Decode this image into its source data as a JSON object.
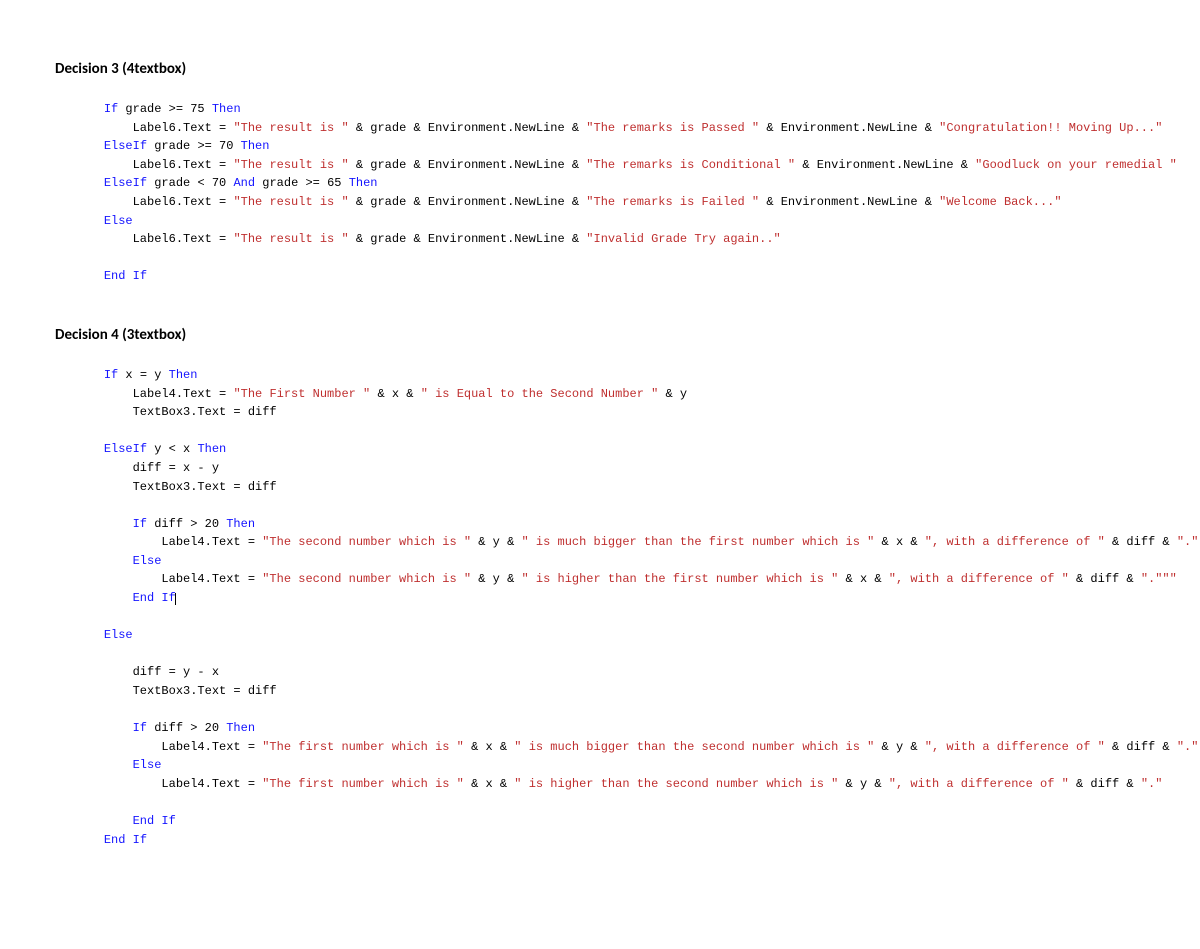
{
  "headings": {
    "h1": "Decision 3 (4textbox)",
    "h2": "Decision 4 (3textbox)"
  },
  "code3": {
    "if1": "If",
    "cond1": " grade >= 75 ",
    "then": "Then",
    "l1a": "        Label6.Text = ",
    "s1a": "\"The result is \"",
    "mid1": " & grade & Environment.NewLine & ",
    "s1b": "\"The remarks is Passed \"",
    "mid1b": " & Environment.NewLine & ",
    "s1c": "\"Congratulation!! Moving Up...\"",
    "elif1": "ElseIf",
    "cond2": " grade >= 70 ",
    "l2a": "        Label6.Text = ",
    "s2a": "\"The result is \"",
    "mid2": " & grade & Environment.NewLine & ",
    "s2b": "\"The remarks is Conditional \"",
    "mid2b": " & Environment.NewLine & ",
    "s2c": "\"Goodluck on your remedial \"",
    "elif2": "ElseIf",
    "cond3a": " grade < 70 ",
    "and": "And",
    "cond3b": " grade >= 65 ",
    "l3a": "        Label6.Text = ",
    "s3a": "\"The result is \"",
    "mid3": " & grade & Environment.NewLine & ",
    "s3b": "\"The remarks is Failed \"",
    "mid3b": " & Environment.NewLine & ",
    "s3c": "\"Welcome Back...\"",
    "else": "Else",
    "l4a": "        Label6.Text = ",
    "s4a": "\"The result is \"",
    "mid4": " & grade & Environment.NewLine & ",
    "s4b": "\"Invalid Grade Try again..\"",
    "endif": "End If"
  },
  "code4": {
    "if1": "If",
    "cond1": " x = y ",
    "then": "Then",
    "l1": "        Label4.Text = ",
    "s1a": "\"The First Number \"",
    "m1a": " & x & ",
    "s1b": "\" is Equal to the Second Number \"",
    "m1b": " & y",
    "l2": "        TextBox3.Text = diff",
    "elif": "ElseIf",
    "cond2": " y < x ",
    "l3": "        diff = x - y",
    "l4": "        TextBox3.Text = diff",
    "if2": "If",
    "cond3": " diff > 20 ",
    "l5": "            Label4.Text = ",
    "s5a": "\"The second number which is \"",
    "m5a": " & y & ",
    "s5b": "\" is much bigger than the first number which is \"",
    "m5b": " & x & ",
    "s5c": "\", with a difference of \"",
    "m5c": " & diff & ",
    "s5d": "\".\"",
    "else1": "Else",
    "l6": "            Label4.Text = ",
    "s6a": "\"The second number which is \"",
    "m6a": " & y & ",
    "s6b": "\" is higher than the first number which is \"",
    "m6b": " & x & ",
    "s6c": "\", with a difference of \"",
    "m6c": " & diff & ",
    "s6d": "\".\"\"\"",
    "endif1": "End If",
    "else2": "Else",
    "l7": "        diff = y - x",
    "l8": "        TextBox3.Text = diff",
    "if3": "If",
    "cond4": " diff > 20 ",
    "l9": "            Label4.Text = ",
    "s9a": "\"The first number which is \"",
    "m9a": " & x & ",
    "s9b": "\" is much bigger than the second number which is \"",
    "m9b": " & y & ",
    "s9c": "\", with a difference of \"",
    "m9c": " & diff & ",
    "s9d": "\".\"",
    "else3": "Else",
    "l10": "            Label4.Text = ",
    "s10a": "\"The first number which is \"",
    "m10a": " & x & ",
    "s10b": "\" is higher than the second number which is \"",
    "m10b": " & y & ",
    "s10c": "\", with a difference of \"",
    "m10c": " & diff & ",
    "s10d": "\".\"",
    "endif2": "End If",
    "endif3": "End If"
  }
}
